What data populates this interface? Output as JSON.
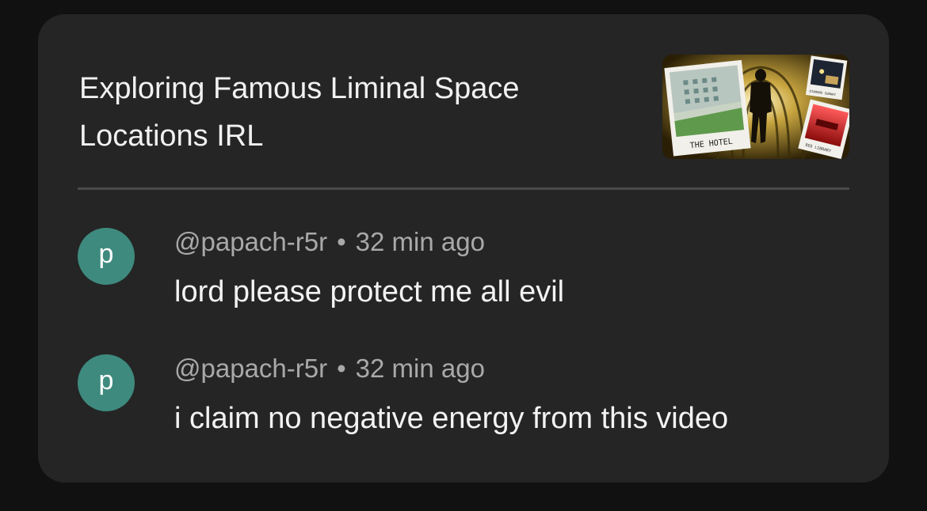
{
  "video": {
    "title": "Exploring Famous Liminal Space Locations IRL",
    "thumbnail": {
      "icon": "video-thumbnail-image",
      "captions": {
        "hotel": "THE HOTEL",
        "diamond": "DIAMOND SUBWAY",
        "library": "RED LIBRARY"
      }
    }
  },
  "comments": [
    {
      "avatar_letter": "p",
      "author": "@papach-r5r",
      "separator": "•",
      "time": "32 min ago",
      "text": "lord please protect me all evil"
    },
    {
      "avatar_letter": "p",
      "author": "@papach-r5r",
      "separator": "•",
      "time": "32 min ago",
      "text": "i claim no negative energy from this video"
    }
  ],
  "colors": {
    "background": "#111111",
    "card": "#252525",
    "avatar": "#3e8a7e",
    "meta_text": "#a9a9a9",
    "body_text": "#f3f3f3"
  }
}
